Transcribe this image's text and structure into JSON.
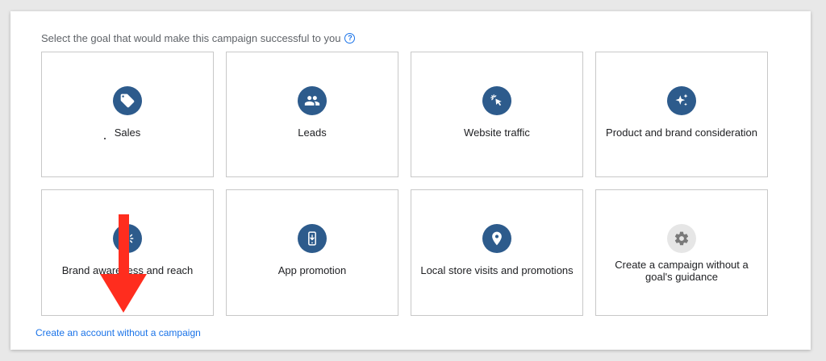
{
  "prompt": {
    "text": "Select the goal that would make this campaign successful to you",
    "help_icon": "help-circle-icon",
    "help_glyph": "?"
  },
  "goals": [
    {
      "label": "Sales",
      "icon": "sales-tag-icon"
    },
    {
      "label": "Leads",
      "icon": "people-icon"
    },
    {
      "label": "Website traffic",
      "icon": "cursor-click-icon"
    },
    {
      "label": "Product and brand consideration",
      "icon": "sparkle-icon"
    },
    {
      "label": "Brand awareness and reach",
      "icon": "speaker-icon"
    },
    {
      "label": "App promotion",
      "icon": "mobile-phone-icon"
    },
    {
      "label": "Local store visits and promotions",
      "icon": "map-pin-icon"
    },
    {
      "label": "Create a campaign without a goal's guidance",
      "icon": "gear-icon"
    }
  ],
  "footer_link": "Create an account without a campaign",
  "colors": {
    "accent": "#1a73e8",
    "icon_bg": "#2d5b8c",
    "icon_bg_neutral": "#e6e6e6",
    "annotation_arrow": "#ff2d1e"
  }
}
